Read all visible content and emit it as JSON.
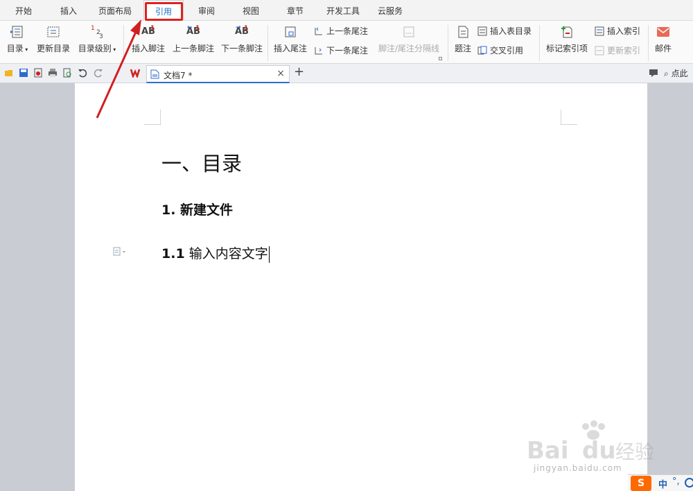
{
  "menu": {
    "tabs": [
      "开始",
      "插入",
      "页面布局",
      "引用",
      "审阅",
      "视图",
      "章节",
      "开发工具",
      "云服务"
    ],
    "active_index": 3
  },
  "ribbon": {
    "toc": "目录",
    "update_toc": "更新目录",
    "toc_level": "目录级别",
    "insert_footnote": "插入脚注",
    "prev_footnote": "上一条脚注",
    "next_footnote": "下一条脚注",
    "insert_endnote": "插入尾注",
    "prev_endnote": "上一条尾注",
    "next_endnote": "下一条尾注",
    "separator_line": "脚注/尾注分隔线",
    "caption": "题注",
    "insert_table_toc": "插入表目录",
    "cross_ref": "交叉引用",
    "mark_index": "标记索引项",
    "insert_index": "插入索引",
    "update_index": "更新索引",
    "mail": "邮件",
    "ab": "AB",
    "sup1": "1",
    "toc_level_nums": [
      "1",
      "2",
      "3"
    ]
  },
  "tabbar": {
    "doc_name": "文档7 *",
    "close": "×",
    "add": "+",
    "search_label": "点此"
  },
  "document": {
    "heading1": "一、目录",
    "heading2": "1. 新建文件",
    "heading3_num": "1.1",
    "heading3_text": "输入内容文字"
  },
  "watermark": {
    "brand": "Bai",
    "brand2": "du",
    "cn": "经验",
    "url": "jingyan.baidu.com"
  },
  "ime": {
    "logo": "S",
    "lang": "中",
    "punct": "°,"
  },
  "colors": {
    "accent": "#1a6fc7",
    "highlight": "#e02020",
    "arrow": "#d11f1f"
  }
}
